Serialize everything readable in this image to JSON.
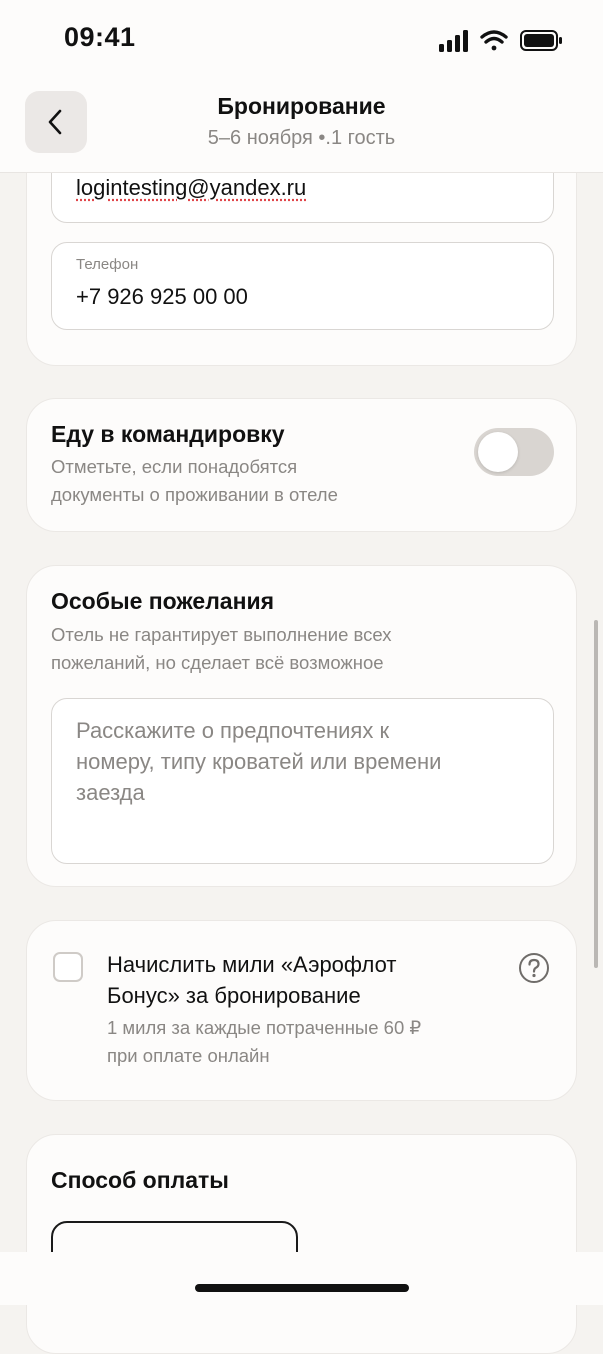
{
  "status_bar": {
    "time": "09:41"
  },
  "header": {
    "title": "Бронирование",
    "subtitle": "5–6 ноября •.1 гость",
    "back_icon": "chevron-left-icon"
  },
  "contacts": {
    "email_value": "logintesting@yandex.ru",
    "phone_label": "Телефон",
    "phone_value": "+7 926 925 00 00"
  },
  "business_trip": {
    "title": "Еду в командировку",
    "description_line1": "Отметьте, если понадобятся",
    "description_line2": "документы о проживании в отеле",
    "toggle_on": false
  },
  "special_requests": {
    "title": "Особые пожелания",
    "description_line1": "Отель не гарантирует выполнение всех",
    "description_line2": "пожеланий, но сделает всё возможное",
    "placeholder_line1": "Расскажите о предпочтениях к",
    "placeholder_line2": "номеру, типу кроватей или времени",
    "placeholder_line3": "заезда"
  },
  "miles": {
    "title_line1": "Начислить мили «Аэрофлот",
    "title_line2": "Бонус» за бронирование",
    "description_line1": "1 миля за каждые потраченные 60 ₽",
    "description_line2": "при оплате онлайн",
    "checked": false,
    "help_icon": "question-circle-icon"
  },
  "payment": {
    "title": "Способ оплаты"
  },
  "colors": {
    "background": "#f5f3f0",
    "card": "#fdfcfb",
    "muted_text": "#8a8784",
    "toggle_off": "#d9d5d1"
  }
}
